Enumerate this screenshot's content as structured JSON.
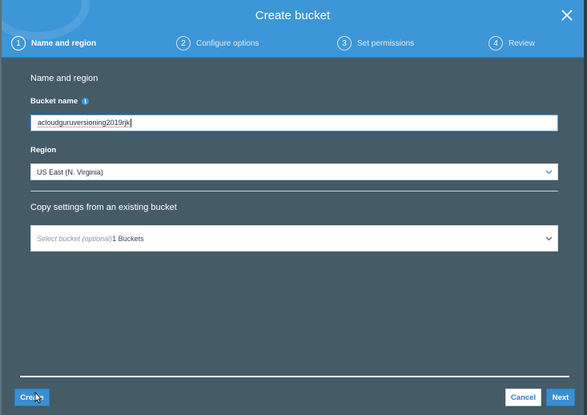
{
  "dialog": {
    "title": "Create bucket",
    "close_icon": "close-icon"
  },
  "steps": [
    {
      "num": "1",
      "label": "Name and region",
      "active": true
    },
    {
      "num": "2",
      "label": "Configure options",
      "active": false
    },
    {
      "num": "3",
      "label": "Set permissions",
      "active": false
    },
    {
      "num": "4",
      "label": "Review",
      "active": false
    }
  ],
  "form": {
    "section_title": "Name and region",
    "bucket_name_label": "Bucket name",
    "info_icon_glyph": "i",
    "bucket_name_value": "acloudguruversioning2019rjk",
    "region_label": "Region",
    "region_value": "US East (N. Virginia)",
    "copy_title": "Copy settings from an existing bucket",
    "copy_placeholder": "Select bucket (optional)",
    "copy_count": "1 Buckets"
  },
  "footer": {
    "create_label": "Create",
    "cancel_label": "Cancel",
    "next_label": "Next"
  },
  "colors": {
    "header": "#3d96d8",
    "body": "#455b66",
    "primary_button": "#3a8fd0",
    "link_blue": "#2e7bc4"
  }
}
